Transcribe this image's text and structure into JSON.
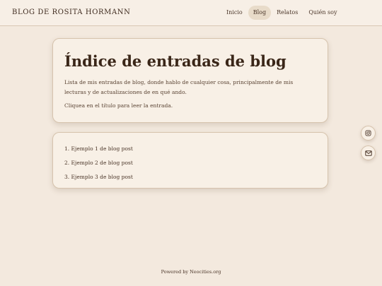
{
  "header": {
    "site_title": "BLOG DE ROSITA HORMANN",
    "nav": [
      {
        "label": "Inicio",
        "active": false
      },
      {
        "label": "Blog",
        "active": true
      },
      {
        "label": "Relatos",
        "active": false
      },
      {
        "label": "Quién soy",
        "active": false
      }
    ]
  },
  "intro": {
    "title": "Índice de entradas de blog",
    "description": "Lista de mis entradas de blog, donde hablo de cualquier cosa, principalmente de mis lecturas y de actualizaciones de en qué ando.",
    "instruction": "Cliquea en el título para leer la entrada."
  },
  "posts": [
    {
      "label": "1. Ejemplo 1 de blog post"
    },
    {
      "label": "2. Ejemplo 2 de blog post"
    },
    {
      "label": "3. Ejemplo 3 de blog post"
    }
  ],
  "social": {
    "buttons": [
      {
        "icon": "instagram-icon"
      },
      {
        "icon": "email-icon"
      }
    ]
  },
  "footer": {
    "prefix": "Powered by ",
    "link_label": "Neocities.org"
  },
  "colors": {
    "background": "#f3e9de",
    "card": "#f8f0e6",
    "border": "#d6c3ad",
    "active_nav": "#e8dbc9",
    "text": "#4a3528"
  }
}
